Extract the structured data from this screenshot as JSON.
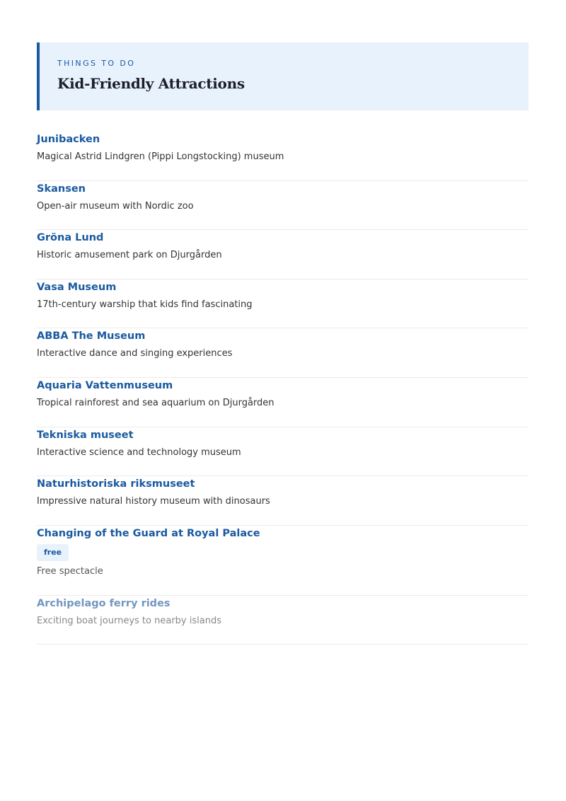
{
  "header": {
    "eyebrow": "THINGS TO DO",
    "title": "Kid-Friendly Attractions"
  },
  "attractions": [
    {
      "name": "Junibacken",
      "description": "Magical Astrid Lindgren (Pippi Longstocking) museum"
    },
    {
      "name": "Skansen",
      "description": "Open-air museum with Nordic zoo"
    },
    {
      "name": "Gröna Lund",
      "description": "Historic amusement park on Djurgården"
    },
    {
      "name": "Vasa Museum",
      "description": "17th-century warship that kids find fascinating"
    },
    {
      "name": "ABBA The Museum",
      "description": "Interactive dance and singing experiences"
    },
    {
      "name": "Aquaria Vattenmuseum",
      "description": "Tropical rainforest and sea aquarium on Djurgården"
    },
    {
      "name": "Tekniska museet",
      "description": "Interactive science and technology museum"
    },
    {
      "name": "Naturhistoriska riksmuseet",
      "description": "Impressive natural history museum with dinosaurs"
    },
    {
      "name": "Changing of the Guard at Royal Palace",
      "tag": "free",
      "description": "Free spectacle"
    },
    {
      "name": "Archipelago ferry rides",
      "description": "Exciting boat journeys to nearby islands"
    }
  ],
  "colors": {
    "accent": "#1a5aa0",
    "header_background": "#e8f2fd",
    "title": "#1b1f2e",
    "body_text": "#333333",
    "divider": "#ececec"
  }
}
